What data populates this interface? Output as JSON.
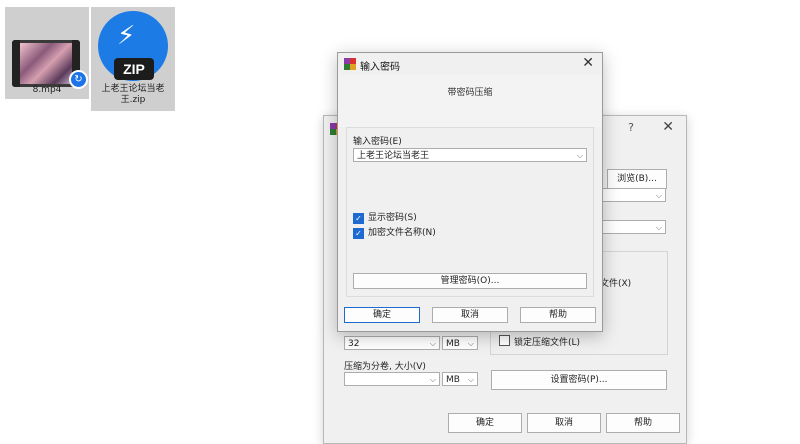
{
  "desktop": {
    "icons": [
      {
        "label": "8.mp4",
        "icon": "video-file-icon"
      },
      {
        "label": "上老王论坛当老王.zip",
        "icon": "zip-file-icon",
        "badge": "ZIP"
      }
    ]
  },
  "bg_dialog": {
    "help": "?",
    "close": "✕",
    "browse_label": "浏览(B)...",
    "add_to_archive_fragment": "文件(X)",
    "dict_size_value": "32",
    "dict_size_unit": "MB",
    "split_label": "压缩为分卷, 大小(V)",
    "split_value": "",
    "split_unit": "MB",
    "lock_archive_label": "锁定压缩文件(L)",
    "set_password_label": "设置密码(P)...",
    "ok_label": "确定",
    "cancel_label": "取消",
    "help_label": "帮助"
  },
  "pw_dialog": {
    "title": "输入密码",
    "close": "✕",
    "subtitle": "带密码压缩",
    "password_label": "输入密码(E)",
    "password_value": "上老王论坛当老王",
    "show_password_label": "显示密码(S)",
    "show_password_checked": true,
    "encrypt_names_label": "加密文件名称(N)",
    "encrypt_names_checked": true,
    "manage_label": "管理密码(O)...",
    "ok_label": "确定",
    "cancel_label": "取消",
    "help_label": "帮助"
  },
  "colors": {
    "accent": "#1d6bd0",
    "zip_icon": "#1d7be5"
  }
}
